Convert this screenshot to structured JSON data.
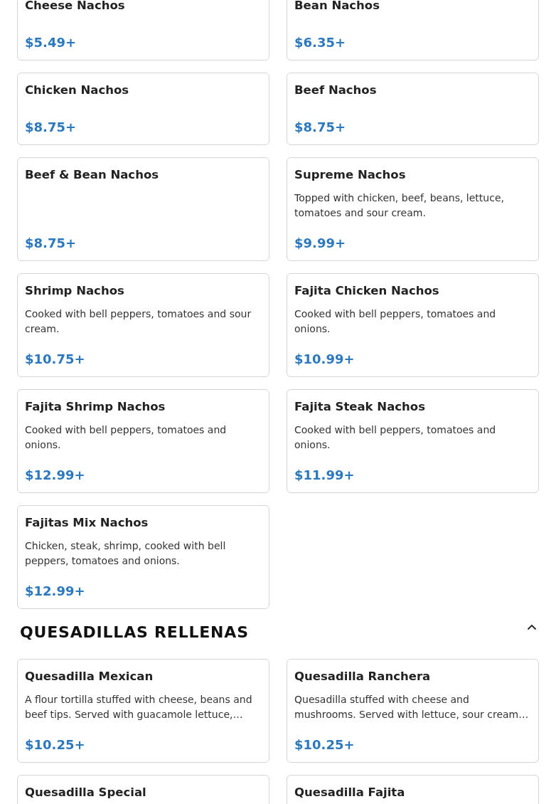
{
  "sections": [
    {
      "items": [
        {
          "name": "Cheese Nachos",
          "price": "$5.49+"
        },
        {
          "name": "Bean Nachos",
          "price": "$6.35+"
        },
        {
          "name": "Chicken Nachos",
          "price": "$8.75+"
        },
        {
          "name": "Beef Nachos",
          "price": "$8.75+"
        },
        {
          "name": "Beef & Bean Nachos",
          "price": "$8.75+"
        },
        {
          "name": "Supreme Nachos",
          "description": "Topped with chicken, beef, beans, lettuce, tomatoes and sour cream.",
          "price": "$9.99+"
        },
        {
          "name": "Shrimp Nachos",
          "description": "Cooked with bell peppers, tomatoes and sour cream.",
          "price": "$10.75+"
        },
        {
          "name": "Fajita Chicken Nachos",
          "description": "Cooked with bell peppers, tomatoes and onions.",
          "price": "$10.99+"
        },
        {
          "name": "Fajita Shrimp Nachos",
          "description": "Cooked with bell peppers, tomatoes and onions.",
          "price": "$12.99+"
        },
        {
          "name": "Fajita Steak Nachos",
          "description": "Cooked with bell peppers, tomatoes and onions.",
          "price": "$11.99+"
        },
        {
          "name": "Fajitas Mix Nachos",
          "description": "Chicken, steak, shrimp, cooked with bell peppers, tomatoes and onions.",
          "price": "$12.99+"
        }
      ]
    },
    {
      "title": "QUESADILLAS RELLENAS",
      "expanded": true,
      "items": [
        {
          "name": "Quesadilla Mexican",
          "description": "A flour tortilla stuffed with cheese, beans and beef tips. Served with guacamole lettuce,…",
          "price": "$10.25+"
        },
        {
          "name": "Quesadilla Ranchera",
          "description": "Quesadilla stuffed with cheese and mushrooms. Served with lettuce, sour cream…",
          "price": "$10.25+"
        },
        {
          "name": "Quesadilla Special"
        },
        {
          "name": "Quesadilla Fajita"
        }
      ]
    }
  ]
}
